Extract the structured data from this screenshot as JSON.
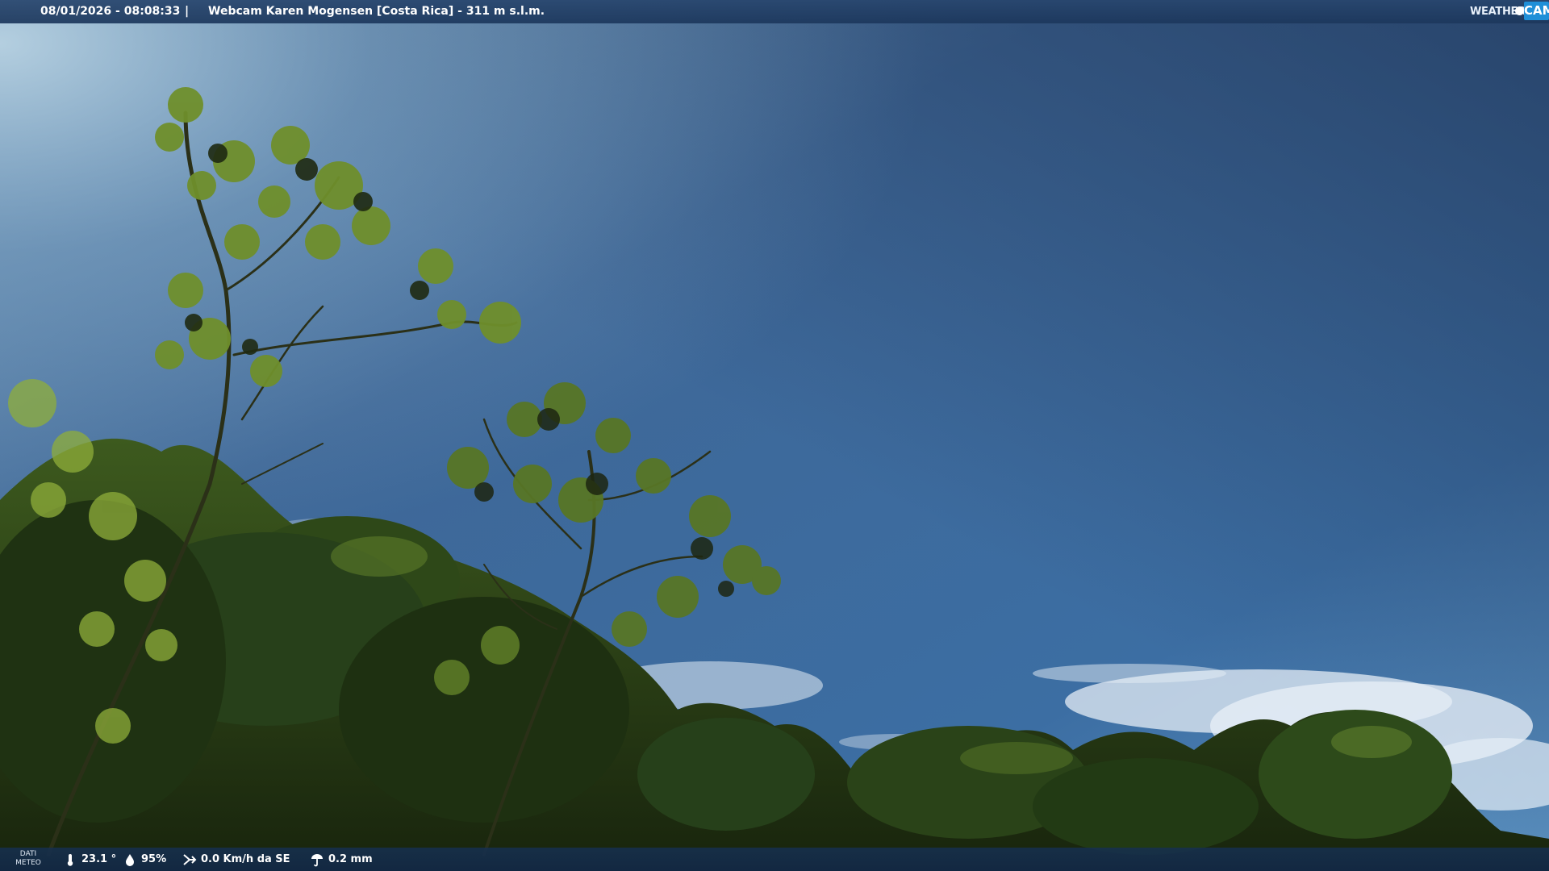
{
  "header": {
    "datetime": "08/01/2026 - 08:08:33",
    "separator": "|",
    "title": "Webcam Karen Mogensen [Costa Rica]  - 311 m s.l.m."
  },
  "brand": {
    "weather": "WEATHER",
    "cam": "CAM"
  },
  "weather_bar": {
    "tag_line1": "DATI",
    "tag_line2": "METEO",
    "temperature": "23.1 °",
    "humidity": "95%",
    "wind": "0.0 Km/h da SE",
    "rain": "0.2 mm"
  },
  "icons": [
    "thermometer-icon",
    "humidity-drop-icon",
    "wind-icon",
    "rain-gauge-icon"
  ],
  "colors": {
    "sky_top": "#2a4a78",
    "sky_mid": "#3c6a9e",
    "sky_bottom": "#4f86b8",
    "foliage_dark": "#1d2b12",
    "foliage_light": "#8fae3a",
    "brand_blue": "#1f8fd8"
  }
}
